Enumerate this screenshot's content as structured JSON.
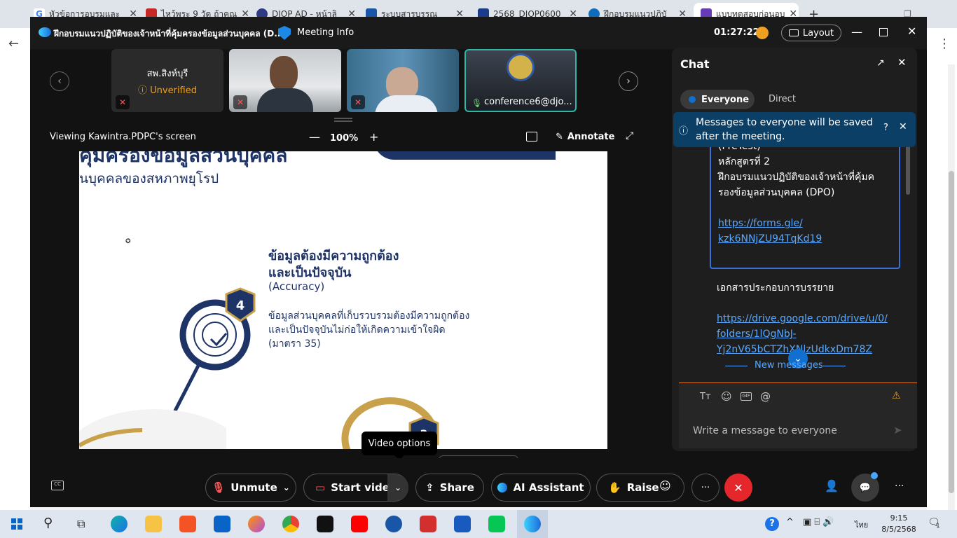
{
  "browser": {
    "tabs": [
      {
        "label": "หัวข้อการอบรมและ",
        "color": "#4285f4"
      },
      {
        "label": "ไหว้พระ 9 วัด ถ้าคุณ",
        "color": "#c62828"
      },
      {
        "label": "DJOP AD - หน้าลิ",
        "color": "#2e3a87"
      },
      {
        "label": "ระบบสารบรรณ",
        "color": "#1a56a8"
      },
      {
        "label": "2568_DJOP0600",
        "color": "#1a3c8a"
      },
      {
        "label": "ฝึกอบรมแนวปฏิบั",
        "color": "#0f6cbd"
      },
      {
        "label": "แบบทดสอบก่อนอบ",
        "color": "#673ab7"
      }
    ],
    "new_tab": "+"
  },
  "meeting": {
    "title": "ฝึกอบรมแนวปฏิบัติของเจ้าหน้าที่คุ้มครองข้อมูลส่วนบุคคล (D...",
    "meeting_info": "Meeting Info",
    "timer": "01:27:22",
    "layout_label": "Layout"
  },
  "participants": [
    {
      "name": "สพ.สิงห์บุรี",
      "status": "Unverified"
    },
    {
      "name": ""
    },
    {
      "name": ""
    },
    {
      "name": "conference6@djo..."
    }
  ],
  "viewbar": {
    "viewing": "Viewing Kawintra.PDPC's screen",
    "zoom": "100%",
    "annotate": "Annotate"
  },
  "slide": {
    "header_line1": "คุ้มครองข้อมูลส่วนบุคคล",
    "header_line2": "นบุคคลของสหภาพยุโรป",
    "heading_line1": "ข้อมูลต้องมีความถูกต้อง",
    "heading_line2": "และเป็นปัจจุบัน",
    "heading_en": "(Accuracy)",
    "badge_number": "4",
    "body_line1": "ข้อมูลส่วนบุคคลที่เก็บรวบรวมต้องมีความถูกต้อง",
    "body_line2": "และเป็นปัจจุบันไม่ก่อให้เกิดความเข้าใจผิด",
    "body_line3": "(มาตรา 35)",
    "badge2_number": "3"
  },
  "tooltip": "Video options",
  "chat": {
    "title": "Chat",
    "tab_everyone": "Everyone",
    "tab_direct": "Direct",
    "banner": "Messages to everyone will be saved after the meeting.",
    "msg_lines": [
      "(PreTest)",
      "หลักสูตรที่ 2",
      "ฝึกอบรมแนวปฏิบัติของเจ้าหน้าที่คุ้มค",
      "รองข้อมูลส่วนบุคคล (DPO)"
    ],
    "link1_line1": "https://forms.gle/",
    "link1_line2": "kzk6NNjZU94TqKd19",
    "msg2": "เอกสารประกอบการบรรยาย",
    "link2_line1": "https://drive.google.com/drive/u/0/",
    "link2_line2": "folders/1lQgNbJ-",
    "link2_line3": "Yj2nV65bCTZhXNlzUdkxDm78Z",
    "new_messages": "New messages",
    "input_placeholder": "Write a message to everyone"
  },
  "controls": {
    "unmute": "Unmute",
    "start_video": "Start video",
    "share": "Share",
    "ai_assistant": "AI Assistant",
    "raise": "Raise"
  },
  "taskbar": {
    "time": "9:15",
    "date": "8/5/2568",
    "lang": "ไทย",
    "notif_count": "1"
  },
  "colors": {
    "accent": "#1170cf",
    "end_call": "#e5272c",
    "slide_navy": "#1f3466",
    "slide_gold": "#c9a14a",
    "link": "#5aa9ff"
  }
}
